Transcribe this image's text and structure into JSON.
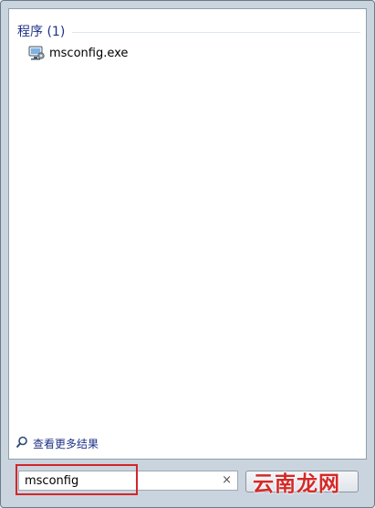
{
  "results": {
    "group_title": "程序 (1)",
    "items": [
      {
        "label": "msconfig.exe",
        "icon": "system-config-icon"
      }
    ],
    "see_more": "查看更多结果"
  },
  "search": {
    "value": "msconfig",
    "clear_glyph": "×"
  },
  "watermark": "云南龙网",
  "colors": {
    "header_text": "#1e3287",
    "highlight": "#d2262a",
    "watermark": "#d42a28"
  }
}
